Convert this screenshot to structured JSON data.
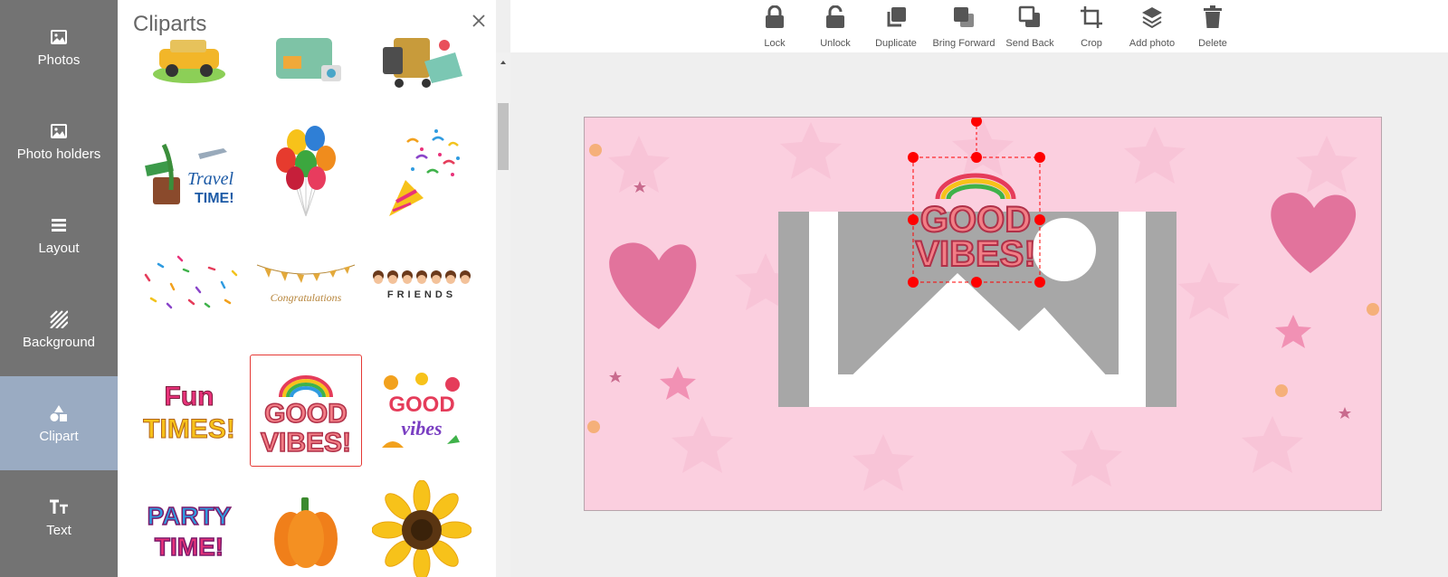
{
  "nav": {
    "items": [
      {
        "label": "Photos",
        "icon": "photo-icon"
      },
      {
        "label": "Photo holders",
        "icon": "photo-icon"
      },
      {
        "label": "Layout",
        "icon": "layout-icon"
      },
      {
        "label": "Background",
        "icon": "stripes-icon"
      },
      {
        "label": "Clipart",
        "icon": "shapes-icon"
      },
      {
        "label": "Text",
        "icon": "text-size-icon"
      }
    ],
    "active": "Clipart"
  },
  "panel": {
    "title": "Cliparts",
    "cliparts": [
      {
        "name": "yellow-car-clipart",
        "text": ""
      },
      {
        "name": "travel-suitcase-camera-clipart",
        "text": ""
      },
      {
        "name": "luggage-cart-map-clipart",
        "text": ""
      },
      {
        "name": "travel-time-clipart",
        "text": "Travel TIME!"
      },
      {
        "name": "balloons-clipart",
        "text": ""
      },
      {
        "name": "party-popper-clipart",
        "text": ""
      },
      {
        "name": "confetti-clipart",
        "text": ""
      },
      {
        "name": "congratulations-bunting-clipart",
        "text": "Congratulations"
      },
      {
        "name": "friends-banner-clipart",
        "text": "FRIENDS"
      },
      {
        "name": "fun-times-clipart",
        "text": "FUN TIMES!"
      },
      {
        "name": "good-vibes-clipart",
        "text": "GOOD VIBES!"
      },
      {
        "name": "good-vibes-floral-clipart",
        "text": "GOOD vibes"
      },
      {
        "name": "party-time-clipart",
        "text": "PARTY TIME!"
      },
      {
        "name": "pumpkin-clipart",
        "text": ""
      },
      {
        "name": "sunflower-clipart",
        "text": ""
      }
    ],
    "selected_index": 10
  },
  "toolbar": {
    "lock": "Lock",
    "unlock": "Unlock",
    "duplicate": "Duplicate",
    "bring_forward": "Bring Forward",
    "send_back": "Send Back",
    "crop": "Crop",
    "add_photo": "Add photo",
    "delete": "Delete"
  },
  "canvas": {
    "background_color": "#fbcfdf",
    "sticker_text_line1": "GOOD",
    "sticker_text_line2": "VIBES!"
  },
  "colors": {
    "nav_bg": "#737373",
    "nav_active": "#9aabc2",
    "handle": "#ff0000",
    "heart": "#e2739c"
  }
}
